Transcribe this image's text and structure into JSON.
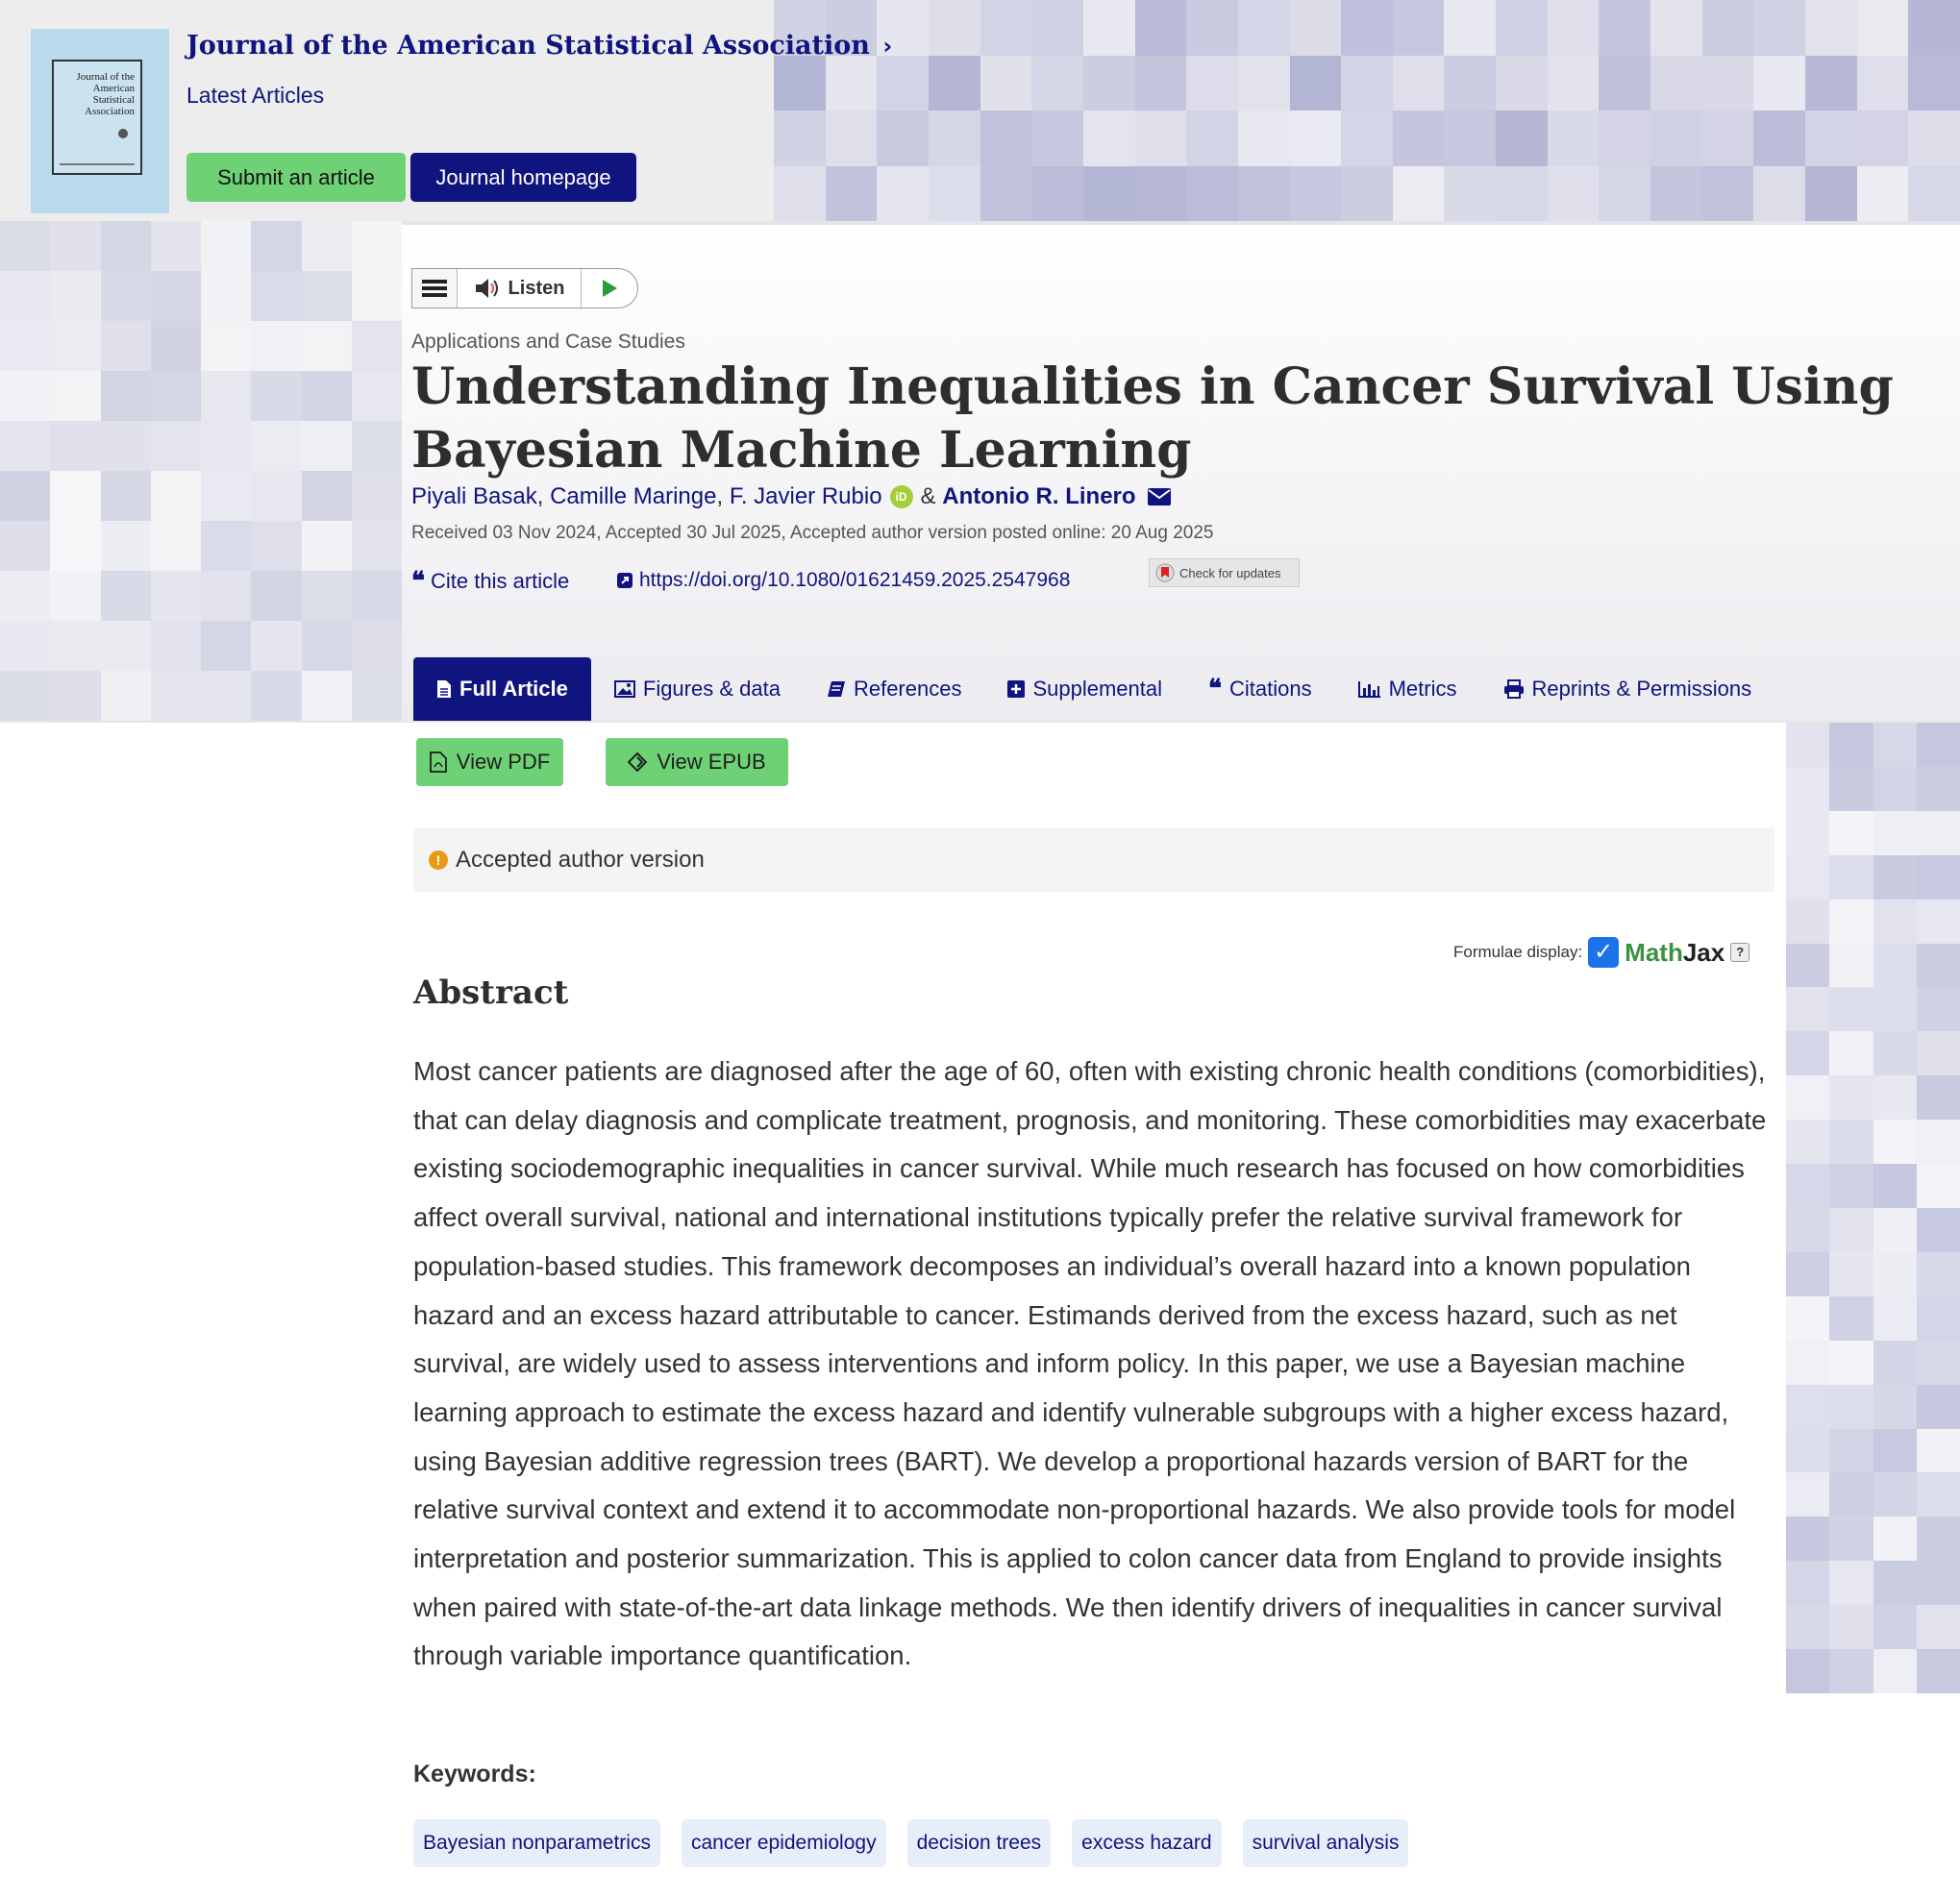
{
  "header": {
    "journal_title": "Journal of the American Statistical Association",
    "latest_articles": "Latest Articles",
    "submit_label": "Submit an article",
    "homepage_label": "Journal homepage",
    "cover_text": "Journal of the American Statistical Association"
  },
  "listen": {
    "label": "Listen"
  },
  "article": {
    "type": "Applications and Case Studies",
    "title": "Understanding Inequalities in Cancer Survival Using Bayesian Machine Learning",
    "authors": [
      {
        "name": "Piyali Basak"
      },
      {
        "name": "Camille Maringe"
      },
      {
        "name": "F. Javier Rubio"
      },
      {
        "name": "Antonio R. Linero"
      }
    ],
    "author_separators": [
      ",",
      ",",
      "&"
    ],
    "orcid_badge": "iD",
    "dates": "Received 03 Nov 2024, Accepted 30 Jul 2025, Accepted author version posted online: 20 Aug 2025",
    "cite_label": "Cite this article",
    "doi": "https://doi.org/10.1080/01621459.2025.2547968",
    "check_updates": "Check for updates"
  },
  "tabs": [
    {
      "label": "Full Article",
      "icon": "document-icon"
    },
    {
      "label": "Figures & data",
      "icon": "image-icon"
    },
    {
      "label": "References",
      "icon": "book-icon"
    },
    {
      "label": "Supplemental",
      "icon": "plus-square-icon"
    },
    {
      "label": "Citations",
      "icon": "quote-icon"
    },
    {
      "label": "Metrics",
      "icon": "bar-chart-icon"
    },
    {
      "label": "Reprints & Permissions",
      "icon": "printer-icon"
    }
  ],
  "actions": {
    "view_pdf": "View PDF",
    "view_epub": "View EPUB"
  },
  "notice": {
    "text": "Accepted author version",
    "icon_glyph": "!"
  },
  "formulae": {
    "label": "Formulae display:",
    "logo_math": "Math",
    "logo_jax": "Jax",
    "help": "?"
  },
  "abstract": {
    "heading": "Abstract",
    "text": "Most cancer patients are diagnosed after the age of 60, often with existing chronic health conditions (comorbidities), that can delay diagnosis and complicate treatment, prognosis, and monitoring. These comorbidities may exacerbate existing sociodemographic inequalities in cancer survival. While much research has focused on how comorbidities affect overall survival, national and international institutions typically prefer the relative survival framework for population-based studies. This framework decomposes an individual’s overall hazard into a known population hazard and an excess hazard attributable to cancer. Estimands derived from the excess hazard, such as net survival, are widely used to assess interventions and inform policy. In this paper, we use a Bayesian machine learning approach to estimate the excess hazard and identify vulnerable subgroups with a higher excess hazard, using Bayesian additive regression trees (BART). We develop a proportional hazards version of BART for the relative survival context and extend it to accommodate non-proportional hazards. We also provide tools for model interpretation and posterior summarization. This is applied to colon cancer data from England to provide insights when paired with state-of-the-art data linkage methods. We then identify drivers of inequalities in cancer survival through variable importance quantification."
  },
  "keywords": {
    "label": "Keywords:",
    "items": [
      "Bayesian nonparametrics",
      "cancer epidemiology",
      "decision trees",
      "excess hazard",
      "survival analysis"
    ]
  },
  "colors": {
    "brand_navy": "#10147e",
    "action_green": "#6fd175",
    "keyword_bg": "#e7eefa",
    "warning_orange": "#e99a14",
    "orcid_green": "#a6ce39"
  }
}
